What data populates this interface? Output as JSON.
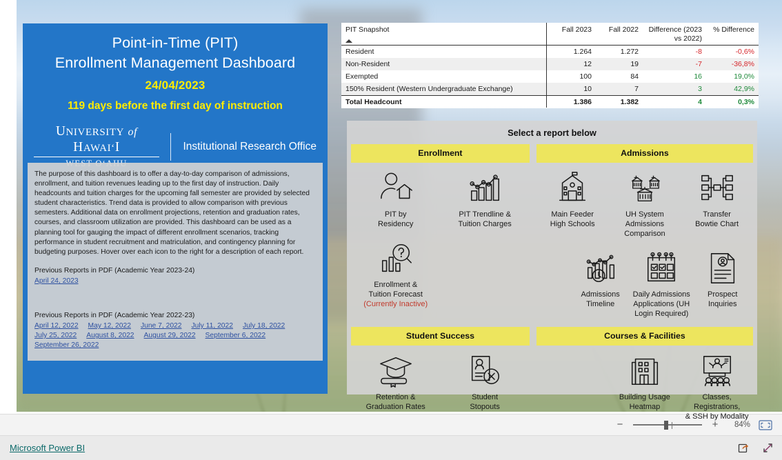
{
  "hero": {
    "title_line1": "Point-in-Time (PIT)",
    "title_line2": "Enrollment Management Dashboard",
    "date": "24/04/2023",
    "countdown": "119 days before the first day of instruction",
    "logo_line1_a": "U",
    "logo_line1_b": "NIVERSITY",
    "logo_line1_c": "of",
    "logo_line1_d": "H",
    "logo_line1_e": "AWAI",
    "logo_line1_f": "ʻ",
    "logo_line1_g": "I",
    "logo_line2": "WEST OʻAHU",
    "office": "Institutional Research Office",
    "accent_blue": "#2376C8",
    "accent_yellow_text": "#FFEC00"
  },
  "description": {
    "body": "The purpose of this dashboard is to offer a day-to-day comparison of admissions, enrollment, and tuition revenues leading up to the first day of instruction. Daily headcounts and tuition charges for the upcoming fall semester are provided by selected student characteristics. Trend data is provided to allow comparison with previous semesters. Additional data on enrollment projections, retention and graduation rates, courses, and classroom utilization are provided. This dashboard can be used as a planning tool for gauging the impact of different enrollment scenarios, tracking performance in student recruitment and matriculation, and contingency planning for budgeting purposes. Hover over each icon to the right for a description of each report.",
    "prev_2324_heading": "Previous Reports in PDF (Academic Year 2023-24)",
    "prev_2324_links": [
      "April 24, 2023"
    ],
    "prev_2223_heading": "Previous Reports in PDF (Academic Year 2022-23)",
    "prev_2223_links": [
      "April 12, 2022",
      "May 12, 2022",
      "June 7, 2022",
      "July 11, 2022",
      "July 18, 2022",
      "July 25, 2022",
      "August 8, 2022",
      "August 29, 2022",
      "September 6, 2022",
      "September 26, 2022"
    ]
  },
  "chart_data": {
    "type": "table",
    "title": "PIT Snapshot",
    "sort_column": "PIT Snapshot",
    "sort_direction": "ascending",
    "columns": [
      "PIT Snapshot",
      "Fall 2023",
      "Fall 2022",
      "Difference (2023 vs 2022)",
      "% Difference"
    ],
    "rows": [
      {
        "label": "Resident",
        "fall_2023": "1.264",
        "fall_2022": "1.272",
        "difference": "-8",
        "pct_difference": "-0,6%",
        "diff_sign": "neg"
      },
      {
        "label": "Non-Resident",
        "fall_2023": "12",
        "fall_2022": "19",
        "difference": "-7",
        "pct_difference": "-36,8%",
        "diff_sign": "neg"
      },
      {
        "label": "Exempted",
        "fall_2023": "100",
        "fall_2022": "84",
        "difference": "16",
        "pct_difference": "19,0%",
        "diff_sign": "pos"
      },
      {
        "label": "150% Resident (Western Undergraduate Exchange)",
        "fall_2023": "10",
        "fall_2022": "7",
        "difference": "3",
        "pct_difference": "42,9%",
        "diff_sign": "pos"
      }
    ],
    "total": {
      "label": "Total Headcount",
      "fall_2023": "1.386",
      "fall_2022": "1.382",
      "difference": "4",
      "pct_difference": "0,3%",
      "diff_sign": "pos"
    },
    "positive_color": "#1F8A3B",
    "negative_color": "#D6252A"
  },
  "selector": {
    "heading": "Select a report below",
    "header_color": "#EDE55E",
    "categories": [
      {
        "name": "Enrollment",
        "tiles": [
          {
            "label": "PIT by\nResidency",
            "icon": "person-house-icon",
            "sub": ""
          },
          {
            "label": "PIT Trendline &\nTuition Charges",
            "icon": "bar-line-chart-icon",
            "sub": ""
          },
          {
            "label": "Enrollment &\nTuition Forecast",
            "icon": "chart-magnifier-question-icon",
            "sub": "(Currently Inactive)"
          }
        ]
      },
      {
        "name": "Admissions",
        "tiles": [
          {
            "label": "Main Feeder\nHigh Schools",
            "icon": "school-building-icon",
            "sub": ""
          },
          {
            "label": "UH System\nAdmissions\nComparison",
            "icon": "multi-campus-icon",
            "sub": ""
          },
          {
            "label": "Transfer\nBowtie Chart",
            "icon": "bowtie-org-chart-icon",
            "sub": ""
          },
          {
            "label": "Admissions\nTimeline",
            "icon": "chart-clock-icon",
            "sub": ""
          },
          {
            "label": "Daily Admissions\nApplications (UH\nLogin Required)",
            "icon": "calendar-checklist-icon",
            "sub": ""
          },
          {
            "label": "Prospect\nInquiries",
            "icon": "person-document-icon",
            "sub": ""
          }
        ]
      },
      {
        "name": "Student Success",
        "tiles": [
          {
            "label": "Retention &\nGraduation Rates",
            "icon": "graduation-cap-diploma-icon",
            "sub": ""
          },
          {
            "label": "Student\nStopouts",
            "icon": "student-card-x-icon",
            "sub": ""
          }
        ]
      },
      {
        "name": "Courses & Facilities",
        "tiles": [
          {
            "label": "Building Usage\nHeatmap",
            "icon": "building-icon",
            "sub": ""
          },
          {
            "label": "Classes, Registrations,\n& SSH by Modality",
            "icon": "classroom-presentation-icon",
            "sub": ""
          }
        ]
      }
    ]
  },
  "zoombar": {
    "minus": "−",
    "plus": "+",
    "zoom_level": "84%",
    "fit_icon": "fit-to-page-icon"
  },
  "statusbar": {
    "brand": "Microsoft Power BI",
    "share_icon": "share-icon",
    "fullscreen_icon": "fullscreen-icon"
  }
}
